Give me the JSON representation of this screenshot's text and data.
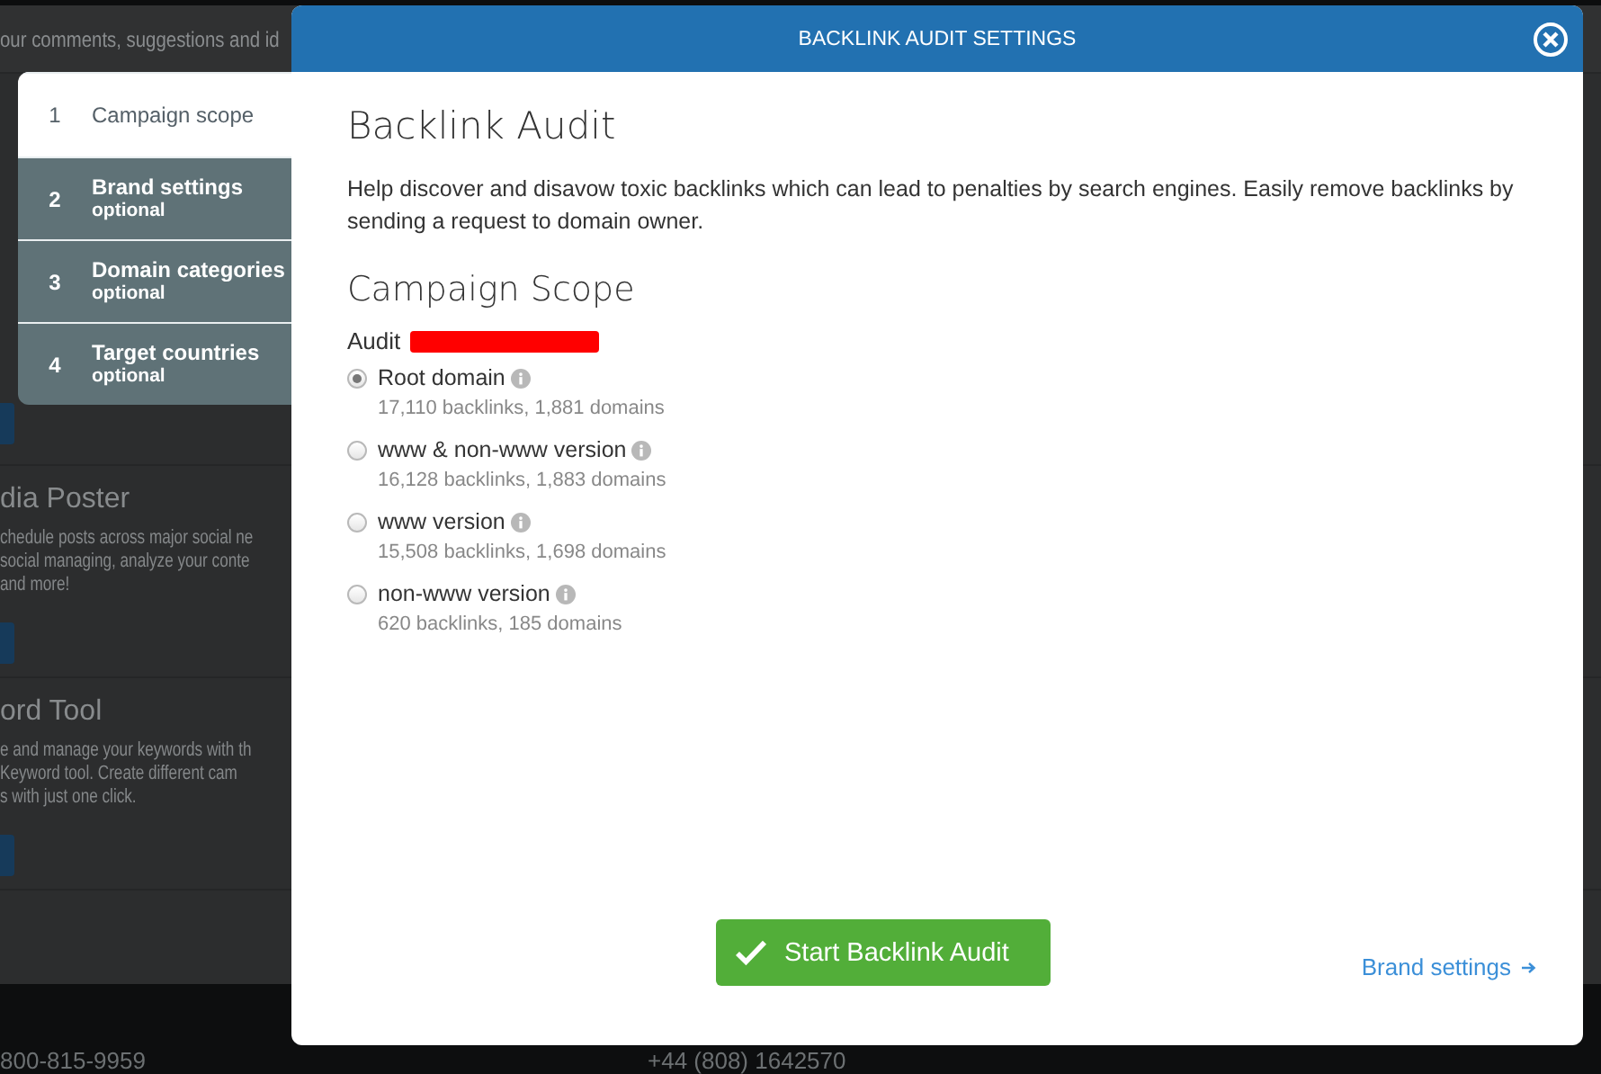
{
  "background": {
    "top_text": "our comments, suggestions and id",
    "cards": [
      {
        "title": "dia Poster",
        "lines": [
          "chedule posts across major social ne",
          "social managing, analyze your conte",
          "and more!"
        ]
      },
      {
        "title": "ord Tool",
        "lines": [
          "e and manage your keywords with th",
          "Keyword tool. Create different cam",
          "s with just one click."
        ]
      }
    ],
    "footer": {
      "phone": "800-815-9959",
      "phone_uk": "+44 (808) 1642570"
    }
  },
  "steps": [
    {
      "number": "1",
      "label": "Campaign scope",
      "selected": true
    },
    {
      "number": "2",
      "label": "Brand settings",
      "note": "optional",
      "selected": false
    },
    {
      "number": "3",
      "label": "Domain categories",
      "note": "optional",
      "selected": false
    },
    {
      "number": "4",
      "label": "Target countries",
      "note": "optional",
      "selected": false
    }
  ],
  "modal": {
    "title": "BACKLINK AUDIT SETTINGS",
    "heading": "Backlink Audit",
    "description": "Help discover and disavow toxic backlinks which can lead to penalties by search engines. Easily remove backlinks by sending a request to domain owner.",
    "section_title": "Campaign Scope",
    "audit_label": "Audit",
    "options": [
      {
        "label": "Root domain",
        "stats": "17,110 backlinks, 1,881 domains",
        "selected": true
      },
      {
        "label": "www & non-www version",
        "stats": "16,128 backlinks, 1,883 domains",
        "selected": false
      },
      {
        "label": "www version",
        "stats": "15,508 backlinks, 1,698 domains",
        "selected": false
      },
      {
        "label": "non-www version",
        "stats": "620 backlinks, 185 domains",
        "selected": false
      }
    ],
    "start_button": "Start Backlink Audit",
    "next_link": "Brand settings"
  }
}
